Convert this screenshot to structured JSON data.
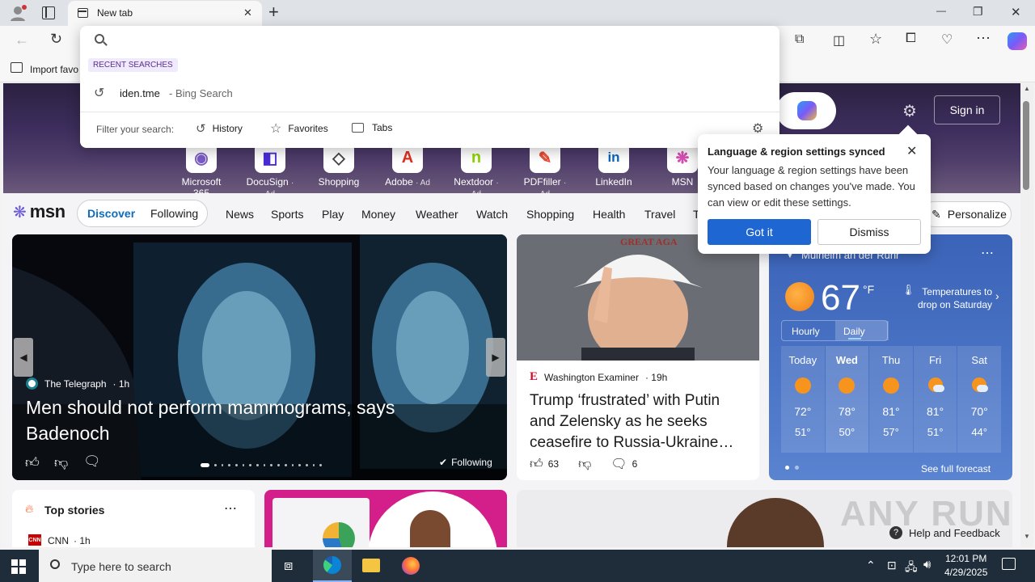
{
  "browser": {
    "tab_title": "New tab",
    "new_tab_symbol": "+",
    "window_controls": {
      "minimize": "—",
      "maximize": "❐",
      "close": "✕"
    },
    "favorites_bar_item": "Import favo"
  },
  "omnibox": {
    "section_label": "RECENT SEARCHES",
    "recent": [
      {
        "query": "iden.tme",
        "source": "- Bing Search"
      }
    ],
    "filter_label": "Filter your search:",
    "filters": [
      "History",
      "Favorites",
      "Tabs"
    ]
  },
  "msn": {
    "sign_in": "Sign in",
    "quick_links": [
      {
        "label": "Microsoft 365",
        "ad": "",
        "glyph": "◉",
        "color": "#7b5cc4"
      },
      {
        "label": "DocuSign",
        "ad": "· Ad",
        "glyph": "◧",
        "color": "#4a2bd6"
      },
      {
        "label": "Shopping",
        "ad": "",
        "glyph": "◇",
        "color": "#444444"
      },
      {
        "label": "Adobe",
        "ad": "· Ad",
        "glyph": "A",
        "color": "#e0301e"
      },
      {
        "label": "Nextdoor",
        "ad": "· Ad",
        "glyph": "n",
        "color": "#8ed500"
      },
      {
        "label": "PDFfiller",
        "ad": "· Ad",
        "glyph": "✎",
        "color": "#e8452c"
      },
      {
        "label": "LinkedIn",
        "ad": "",
        "glyph": "in",
        "color": "#0a66c2"
      },
      {
        "label": "MSN",
        "ad": "",
        "glyph": "❋",
        "color": "#d64fb5"
      }
    ],
    "logo": "msn",
    "nav_tabs": [
      "Discover",
      "Following"
    ],
    "nav_items": [
      "News",
      "Sports",
      "Play",
      "Money",
      "Weather",
      "Watch",
      "Shopping",
      "Health",
      "Travel",
      "T"
    ],
    "personalize": "Personalize",
    "hero": {
      "source": "The Telegraph",
      "age": "· 1h",
      "headline": "Men should not perform mammograms, says Badenoch",
      "following": "Following"
    },
    "story2": {
      "source": "Washington Examiner",
      "age": "· 19h",
      "headline": "Trump ‘frustrated’ with Putin and Zelensky as he seeks ceasefire to Russia-Ukraine…",
      "likes": "63",
      "comments": "6",
      "cap_text": "GREAT AGA"
    },
    "weather": {
      "location": "Mülheim an der Ruhr",
      "temp": "67",
      "unit": "°F",
      "note": "Temperatures to drop on Saturday",
      "tabs": [
        "Hourly",
        "Daily"
      ],
      "days": [
        {
          "day": "Today",
          "hi": "72°",
          "lo": "51°",
          "icon": "sun"
        },
        {
          "day": "Wed",
          "hi": "78°",
          "lo": "50°",
          "icon": "sun"
        },
        {
          "day": "Thu",
          "hi": "81°",
          "lo": "57°",
          "icon": "sun"
        },
        {
          "day": "Fri",
          "hi": "81°",
          "lo": "51°",
          "icon": "partly-cloudy"
        },
        {
          "day": "Sat",
          "hi": "70°",
          "lo": "44°",
          "icon": "partly-cloudy"
        }
      ],
      "full_forecast": "See full forecast"
    },
    "top_stories": {
      "title": "Top stories",
      "first_source": "CNN",
      "first_age": "· 1h"
    },
    "help": "Help and Feedback",
    "watermark": "ANY RUN"
  },
  "popup": {
    "title": "Language & region settings synced",
    "body": "Your language & region settings have been synced based on changes you've made. You can view or edit these settings.",
    "primary": "Got it",
    "secondary": "Dismiss"
  },
  "taskbar": {
    "search_placeholder": "Type here to search",
    "time": "12:01 PM",
    "date": "4/29/2025"
  },
  "colors": {
    "accent": "#0f6cbd",
    "msn_blue": "#0f6cbd",
    "taskbar": "#1f2d3a"
  }
}
